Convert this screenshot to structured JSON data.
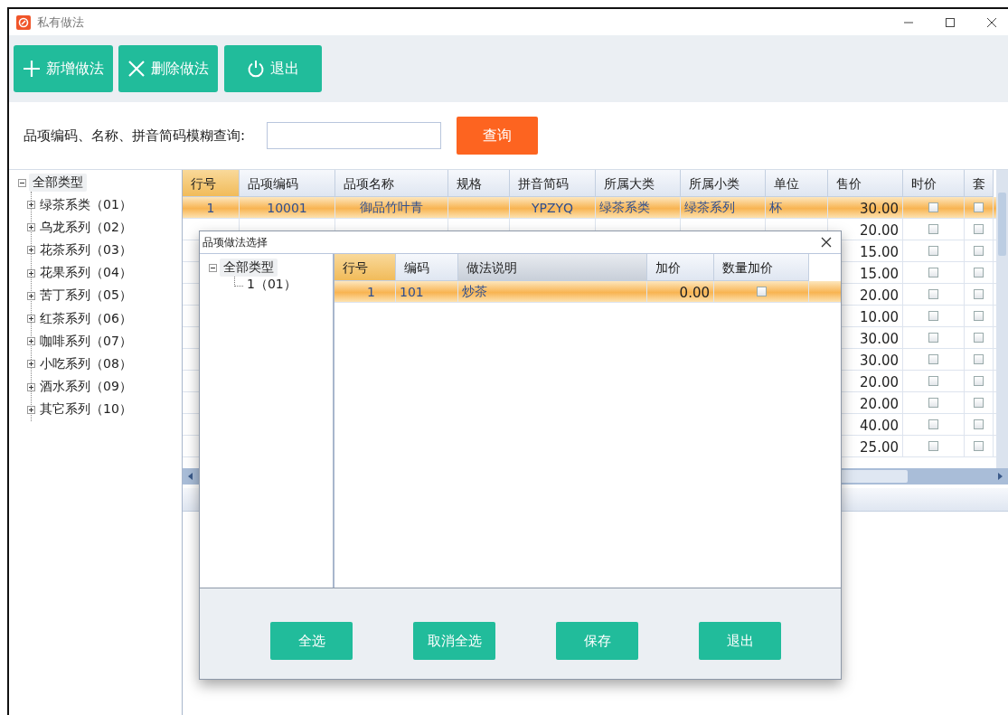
{
  "window": {
    "title": "私有做法"
  },
  "toolbar": [
    {
      "kind": "add",
      "label": "新增做法"
    },
    {
      "kind": "delete",
      "label": "删除做法"
    },
    {
      "kind": "exit",
      "label": "退出"
    }
  ],
  "search": {
    "label": "品项编码、名称、拼音简码模糊查询:",
    "button": "查询"
  },
  "tree": {
    "label": "全部类型",
    "expanded": true,
    "children": [
      {
        "label": "绿茶系类（01）",
        "expanded": false
      },
      {
        "label": "乌龙系列（02）",
        "expanded": false
      },
      {
        "label": "花茶系列（03）",
        "expanded": false
      },
      {
        "label": "花果系列（04）",
        "expanded": false
      },
      {
        "label": "苦丁系列（05）",
        "expanded": false
      },
      {
        "label": "红茶系列（06）",
        "expanded": false
      },
      {
        "label": "咖啡系列（07）",
        "expanded": false
      },
      {
        "label": "小吃系列（08）",
        "expanded": false
      },
      {
        "label": "酒水系列（09）",
        "expanded": false
      },
      {
        "label": "其它系列（10）",
        "expanded": false
      }
    ]
  },
  "grid": {
    "columns": [
      "行号",
      "品项编码",
      "品项名称",
      "规格",
      "拼音简码",
      "所属大类",
      "所属小类",
      "单位",
      "售价",
      "时价",
      "套"
    ],
    "rows": [
      {
        "row_no": "1",
        "code": "10001",
        "name": "御品竹叶青",
        "pinyin": "YPZYQ",
        "category": "绿茶系类",
        "subcategory": "绿茶系列",
        "unit": "杯",
        "price": "30.00",
        "time_price": false,
        "set_meal": false,
        "selected": true
      },
      {
        "price": "20.00",
        "time_price": false,
        "set_meal": false,
        "selected": false
      },
      {
        "price": "15.00",
        "time_price": false,
        "set_meal": false,
        "selected": false
      },
      {
        "price": "15.00",
        "time_price": false,
        "set_meal": false,
        "selected": false
      },
      {
        "price": "20.00",
        "time_price": false,
        "set_meal": false,
        "selected": false
      },
      {
        "price": "10.00",
        "time_price": false,
        "set_meal": false,
        "selected": false
      },
      {
        "price": "30.00",
        "time_price": false,
        "set_meal": false,
        "selected": false
      },
      {
        "price": "30.00",
        "time_price": false,
        "set_meal": false,
        "selected": false
      },
      {
        "price": "20.00",
        "time_price": false,
        "set_meal": false,
        "selected": false
      },
      {
        "price": "20.00",
        "time_price": false,
        "set_meal": false,
        "selected": false
      },
      {
        "price": "40.00",
        "time_price": false,
        "set_meal": false,
        "selected": false
      },
      {
        "price": "25.00",
        "time_price": false,
        "set_meal": false,
        "selected": false
      }
    ]
  },
  "dialog": {
    "title": "品项做法选择",
    "tree": {
      "label": "全部类型",
      "expanded": true,
      "children": [
        {
          "label": "1（01）"
        }
      ]
    },
    "columns": [
      "行号",
      "编码",
      "做法说明",
      "加价",
      "数量加价"
    ],
    "rows": [
      {
        "row_no": "1",
        "code": "101",
        "description": "炒茶",
        "surcharge": "0.00",
        "qty_surcharge": false,
        "selected": true
      }
    ],
    "buttons": [
      "全选",
      "取消全选",
      "保存",
      "退出"
    ]
  }
}
